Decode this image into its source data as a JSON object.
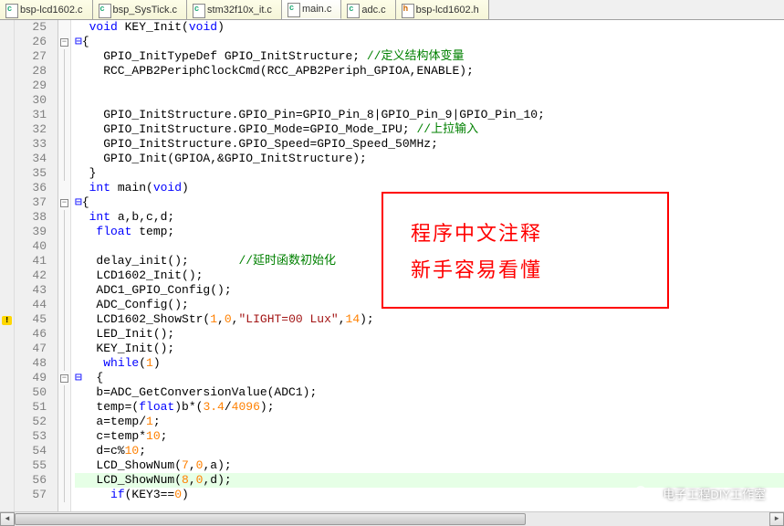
{
  "tabs": [
    {
      "label": "bsp-lcd1602.c",
      "icon": "c",
      "active": false
    },
    {
      "label": "bsp_SysTick.c",
      "icon": "c",
      "active": false
    },
    {
      "label": "stm32f10x_it.c",
      "icon": "c",
      "active": false
    },
    {
      "label": "main.c",
      "icon": "c",
      "active": true
    },
    {
      "label": "adc.c",
      "icon": "c",
      "active": false
    },
    {
      "label": "bsp-lcd1602.h",
      "icon": "h",
      "active": false
    }
  ],
  "lines": [
    {
      "n": "25",
      "fold": "",
      "c": "  <span class='kw-blue'>void</span> KEY_Init(<span class='kw-blue'>void</span>)"
    },
    {
      "n": "26",
      "fold": "-",
      "c": "<span class='kw-blue'>⊟</span>{"
    },
    {
      "n": "27",
      "fold": "|",
      "c": "    GPIO_InitTypeDef GPIO_InitStructure; <span class='cmt'>//定义结构体变量</span>"
    },
    {
      "n": "28",
      "fold": "|",
      "c": "    RCC_APB2PeriphClockCmd(RCC_APB2Periph_GPIOA,ENABLE);"
    },
    {
      "n": "29",
      "fold": "|",
      "c": ""
    },
    {
      "n": "30",
      "fold": "|",
      "c": ""
    },
    {
      "n": "31",
      "fold": "|",
      "c": "    GPIO_InitStructure.GPIO_Pin=GPIO_Pin_8|GPIO_Pin_9|GPIO_Pin_10;"
    },
    {
      "n": "32",
      "fold": "|",
      "c": "    GPIO_InitStructure.GPIO_Mode=GPIO_Mode_IPU; <span class='cmt'>//上拉输入</span>"
    },
    {
      "n": "33",
      "fold": "|",
      "c": "    GPIO_InitStructure.GPIO_Speed=GPIO_Speed_50MHz;"
    },
    {
      "n": "34",
      "fold": "|",
      "c": "    GPIO_Init(GPIOA,&GPIO_InitStructure);"
    },
    {
      "n": "35",
      "fold": "L",
      "c": "  }"
    },
    {
      "n": "36",
      "fold": "",
      "c": "  <span class='kw-blue'>int</span> main(<span class='kw-blue'>void</span>)"
    },
    {
      "n": "37",
      "fold": "-",
      "c": "<span class='kw-blue'>⊟</span>{"
    },
    {
      "n": "38",
      "fold": "|",
      "c": "  <span class='kw-blue'>int</span> a,b,c,d;"
    },
    {
      "n": "39",
      "fold": "|",
      "c": "   <span class='kw-blue'>float</span> temp;"
    },
    {
      "n": "40",
      "fold": "|",
      "c": ""
    },
    {
      "n": "41",
      "fold": "|",
      "c": "   delay_init();       <span class='cmt'>//延时函数初始化</span>"
    },
    {
      "n": "42",
      "fold": "|",
      "c": "   LCD1602_Init();"
    },
    {
      "n": "43",
      "fold": "|",
      "c": "   ADC1_GPIO_Config();"
    },
    {
      "n": "44",
      "fold": "|",
      "c": "   ADC_Config();"
    },
    {
      "n": "45",
      "fold": "|",
      "warn": true,
      "c": "   LCD1602_ShowStr(<span class='num'>1</span>,<span class='num'>0</span>,<span class='str'>\"LIGHT=00 Lux\"</span>,<span class='num'>14</span>);"
    },
    {
      "n": "46",
      "fold": "|",
      "c": "   LED_Init();"
    },
    {
      "n": "47",
      "fold": "|",
      "c": "   KEY_Init();"
    },
    {
      "n": "48",
      "fold": "|",
      "c": "    <span class='kw-blue'>while</span>(<span class='num'>1</span>)"
    },
    {
      "n": "49",
      "fold": "-",
      "c": "<span class='kw-blue'>⊟</span>  {"
    },
    {
      "n": "50",
      "fold": "|",
      "c": "   b=ADC_GetConversionValue(ADC1);"
    },
    {
      "n": "51",
      "fold": "|",
      "c": "   temp=(<span class='kw-blue'>float</span>)b*(<span class='num'>3.4</span>/<span class='num'>4096</span>);"
    },
    {
      "n": "52",
      "fold": "|",
      "c": "   a=temp/<span class='num'>1</span>;"
    },
    {
      "n": "53",
      "fold": "|",
      "c": "   c=temp*<span class='num'>10</span>;"
    },
    {
      "n": "54",
      "fold": "|",
      "c": "   d=c%<span class='num'>10</span>;"
    },
    {
      "n": "55",
      "fold": "|",
      "c": "   LCD_ShowNum(<span class='num'>7</span>,<span class='num'>0</span>,a);"
    },
    {
      "n": "56",
      "fold": "|",
      "hl": true,
      "c": "   LCD_ShowNum(<span class='num'>8</span>,<span class='num'>0</span>,d);"
    },
    {
      "n": "57",
      "fold": "|",
      "c": "     <span class='kw-blue'>if</span>(KEY3==<span class='num'>0</span>)"
    }
  ],
  "annotation": {
    "line1": "程序中文注释",
    "line2": "新手容易看懂"
  },
  "watermark": "电子工程DIY工作室"
}
